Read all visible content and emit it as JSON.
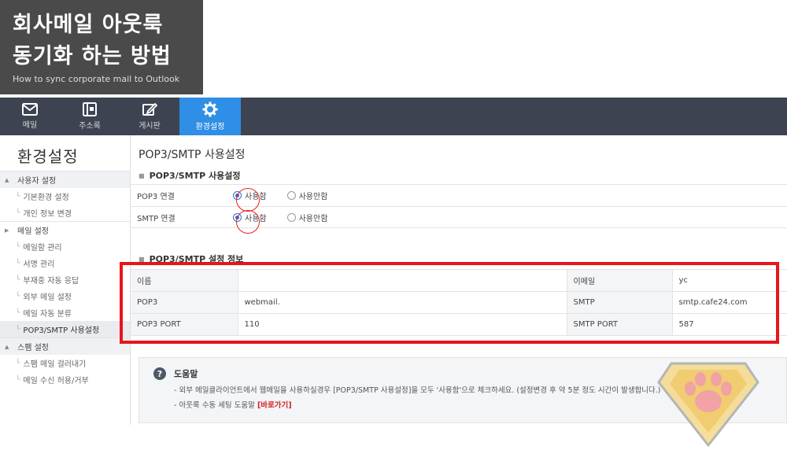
{
  "banner": {
    "line1": "회사메일 아웃룩",
    "line2": "동기화 하는 방법",
    "subtitle": "How to sync corporate mail to Outlook"
  },
  "nav": {
    "items": [
      {
        "label": "메일",
        "icon": "mail-icon"
      },
      {
        "label": "주소록",
        "icon": "address-book-icon"
      },
      {
        "label": "게시판",
        "icon": "edit-icon"
      },
      {
        "label": "환경설정",
        "icon": "gear-icon",
        "active": true
      }
    ],
    "active_color": "#2f8ee5",
    "bg_color": "#3d4351"
  },
  "sidebar": {
    "title": "환경설정",
    "group1": {
      "label": "사용자 설정",
      "items": [
        "기본환경 설정",
        "개인 정보 변경"
      ]
    },
    "group2": {
      "label": "메일 설정",
      "items": [
        "메일함 관리",
        "서명 관리",
        "부재중 자동 응답",
        "외부 메일 설정",
        "메일 자동 분류",
        "POP3/SMTP 사용설정"
      ]
    },
    "group3": {
      "label": "스팸 설정",
      "items": [
        "스팸 메일 걸러내기",
        "메일 수신 허용/거부"
      ]
    }
  },
  "main": {
    "page_title": "POP3/SMTP 사용설정",
    "section1_title": "POP3/SMTP 사용설정",
    "pop3": {
      "label": "POP3 연결",
      "on": "사용함",
      "off": "사용안함"
    },
    "smtp": {
      "label": "SMTP 연결",
      "on": "사용함",
      "off": "사용안함"
    },
    "section2_title": "POP3/SMTP 설정 정보",
    "table": {
      "name_label": "이름",
      "name_value": "",
      "email_label": "이메일",
      "email_value": "yc",
      "pop3_label": "POP3",
      "pop3_value": "webmail.",
      "smtp_label": "SMTP",
      "smtp_value": "smtp.cafe24.com",
      "pop3_port_label": "POP3 PORT",
      "pop3_port_value": "110",
      "smtp_port_label": "SMTP PORT",
      "smtp_port_value": "587"
    },
    "help": {
      "title": "도움말",
      "line1": "- 외부 메일클라이언트에서 웹메일을 사용하실경우 [POP3/SMTP 사용설정]을 모두 '사용함'으로 체크하세요. (설정변경 후 약 5분 정도 시간이 발생합니다.)",
      "line2_prefix": "- 아웃룩 수동 세팅 도움말",
      "line2_link": "[바로가기]"
    }
  },
  "colors": {
    "highlight_red": "#e8141b",
    "radio_blue": "#2f6fd6"
  }
}
